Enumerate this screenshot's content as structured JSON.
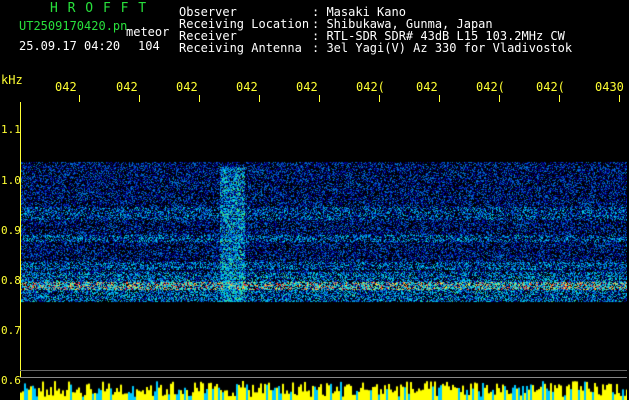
{
  "header": {
    "station_title": "H R O F F T",
    "file_name": "UT2509170420.pn",
    "meteor_label": "meteor",
    "timestamp": "25.09.17 04:20",
    "meteor_count": "104",
    "fields": [
      {
        "label": "Observer",
        "value": ": Masaki Kano"
      },
      {
        "label": "Receiving Location",
        "value": ": Shibukawa, Gunma, Japan"
      },
      {
        "label": "Receiver",
        "value": ": RTL-SDR SDR# 43dB L15 103.2MHz CW"
      },
      {
        "label": "Receiving Antenna",
        "value": ": 3el Yagi(V) Az 330 for Vladivostok"
      }
    ]
  },
  "axis": {
    "unit": "kHz",
    "y_labels": [
      "1.1",
      "1.0",
      "0.9",
      "0.8",
      "0.7",
      "0.6"
    ],
    "x_labels": [
      "042",
      "042",
      "042",
      "042",
      "042",
      "042(",
      "042",
      "042(",
      "042(",
      "0430"
    ]
  },
  "colors": {
    "title_green": "#28e03c",
    "axis_yellow": "#ffff33",
    "background": "#000000"
  }
}
